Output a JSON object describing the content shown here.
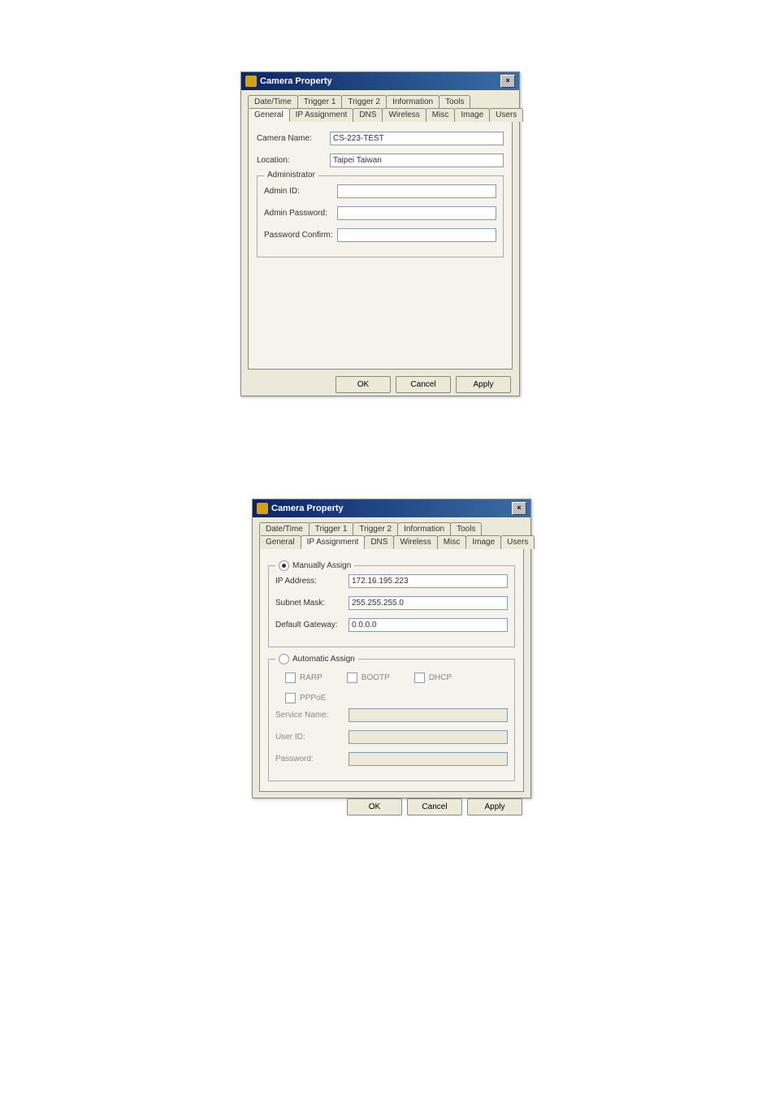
{
  "dialog1": {
    "title": "Camera Property",
    "close": "×",
    "tabs_row1": [
      "Date/Time",
      "Trigger 1",
      "Trigger 2",
      "Information",
      "Tools"
    ],
    "tabs_row2": [
      "General",
      "IP Assignment",
      "DNS",
      "Wireless",
      "Misc",
      "Image",
      "Users"
    ],
    "active_tab": "General",
    "camera_name_label": "Camera Name:",
    "camera_name_value": "CS-223-TEST",
    "location_label": "Location:",
    "location_value": "Taipei Taiwan",
    "admin_group": "Administrator",
    "admin_id_label": "Admin ID:",
    "admin_id_value": "",
    "admin_pw_label": "Admin Password:",
    "admin_pw_value": "",
    "pw_confirm_label": "Password Confirm:",
    "pw_confirm_value": "",
    "ok": "OK",
    "cancel": "Cancel",
    "apply": "Apply"
  },
  "dialog2": {
    "title": "Camera Property",
    "close": "×",
    "tabs_row1": [
      "Date/Time",
      "Trigger 1",
      "Trigger 2",
      "Information",
      "Tools"
    ],
    "tabs_row2": [
      "General",
      "IP Assignment",
      "DNS",
      "Wireless",
      "Misc",
      "Image",
      "Users"
    ],
    "active_tab": "IP Assignment",
    "manual_group": "Manually Assign",
    "ip_label": "IP Address:",
    "ip_value": "172.16.195.223",
    "subnet_label": "Subnet Mask:",
    "subnet_value": "255.255.255.0",
    "gateway_label": "Default Gateway:",
    "gateway_value": "0.0.0.0",
    "auto_group": "Automatic Assign",
    "rarp": "RARP",
    "bootp": "BOOTP",
    "dhcp": "DHCP",
    "pppoe": "PPPoE",
    "service_label": "Service Name:",
    "service_value": "",
    "user_label": "User ID:",
    "user_value": "",
    "password_label": "Password:",
    "password_value": "",
    "ok": "OK",
    "cancel": "Cancel",
    "apply": "Apply"
  }
}
